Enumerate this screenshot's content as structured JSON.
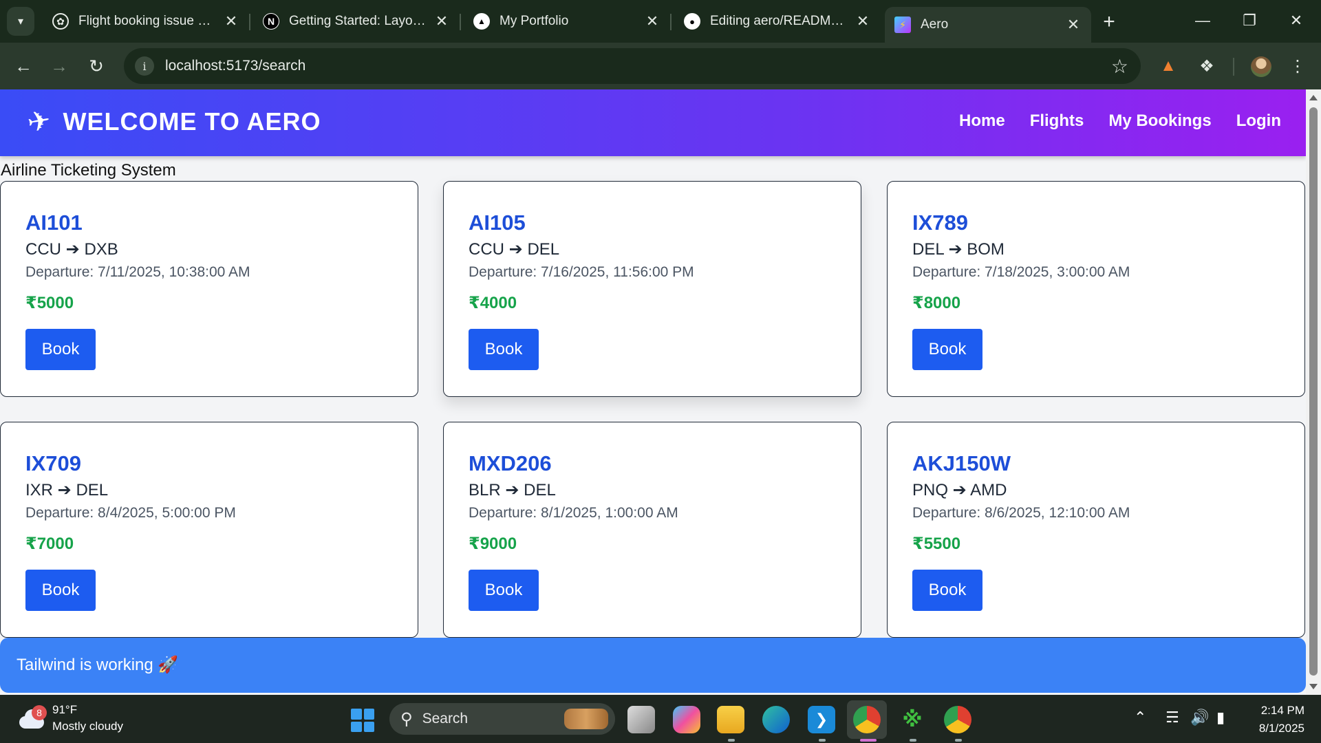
{
  "browser": {
    "tabs": [
      {
        "title": "Flight booking issue debu",
        "icon": "chatgpt-icon"
      },
      {
        "title": "Getting Started: Layouts a",
        "icon": "nextjs-icon"
      },
      {
        "title": "My Portfolio",
        "icon": "vercel-icon"
      },
      {
        "title": "Editing aero/README.md",
        "icon": "github-icon"
      },
      {
        "title": "Aero",
        "icon": "vite-icon",
        "active": true
      }
    ],
    "url": "localhost:5173/search"
  },
  "app": {
    "brand": "WELCOME TO AERO",
    "nav": [
      "Home",
      "Flights",
      "My Bookings",
      "Login"
    ],
    "subtitle": "Airline Ticketing System",
    "flights": [
      {
        "number": "AI101",
        "route": "CCU ➔ DXB",
        "departure": "Departure: 7/11/2025, 10:38:00 AM",
        "price": "₹5000",
        "action": "Book"
      },
      {
        "number": "AI105",
        "route": "CCU ➔ DEL",
        "departure": "Departure: 7/16/2025, 11:56:00 PM",
        "price": "₹4000",
        "action": "Book"
      },
      {
        "number": "IX789",
        "route": "DEL ➔ BOM",
        "departure": "Departure: 7/18/2025, 3:00:00 AM",
        "price": "₹8000",
        "action": "Book"
      },
      {
        "number": "IX709",
        "route": "IXR ➔ DEL",
        "departure": "Departure: 8/4/2025, 5:00:00 PM",
        "price": "₹7000",
        "action": "Book"
      },
      {
        "number": "MXD206",
        "route": "BLR ➔ DEL",
        "departure": "Departure: 8/1/2025, 1:00:00 AM",
        "price": "₹9000",
        "action": "Book"
      },
      {
        "number": "AKJ150W",
        "route": "PNQ ➔ AMD",
        "departure": "Departure: 8/6/2025, 12:10:00 AM",
        "price": "₹5500",
        "action": "Book"
      }
    ],
    "footer": "Tailwind is working 🚀"
  },
  "taskbar": {
    "weather_temp": "91°F",
    "weather_desc": "Mostly cloudy",
    "weather_badge": "8",
    "search": "Search",
    "time": "2:14 PM",
    "date": "8/1/2025"
  },
  "colors": {
    "header_gradient": [
      "#3a4cf6",
      "#9a20f0"
    ],
    "flight_number": "#1d4ed8",
    "price": "#16a34a",
    "button": "#1d5cf0",
    "footer": "#3b82f6"
  }
}
